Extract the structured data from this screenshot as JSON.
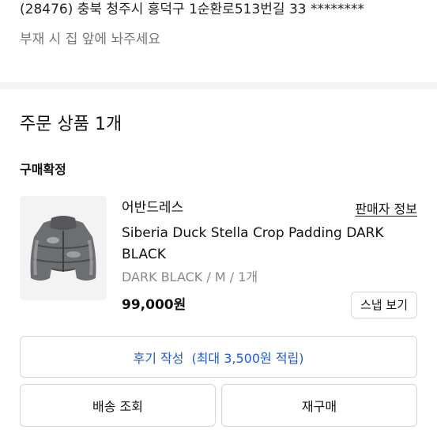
{
  "shipping": {
    "address": "(28476) 충북 청주시 흥덕구 1순환로513번길 33 ********",
    "memo": "부재 시 집 앞에 놔주세요"
  },
  "order": {
    "section_title": "주문 상품 1개",
    "status": "구매확정",
    "product": {
      "brand": "어반드레스",
      "seller_info_label": "판매자 정보",
      "name": "Siberia Duck Stella Crop Padding DARK BLACK",
      "option": "DARK BLACK / M / 1개",
      "price": "99,000원",
      "snap_label": "스냅 보기",
      "image_icon": "puffer-jacket-image"
    },
    "review": {
      "label": "후기 작성",
      "reward": "(최대 3,500원 적립)"
    },
    "actions": {
      "track_label": "배송 조회",
      "reorder_label": "재구매"
    }
  },
  "colors": {
    "accent": "#1f5bd6",
    "divider": "#f4f4f5",
    "border": "#d6d6d9",
    "muted_text": "#888888"
  }
}
